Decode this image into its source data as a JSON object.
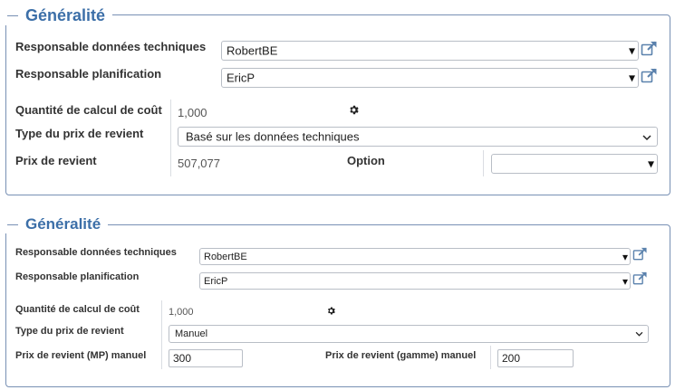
{
  "panel1": {
    "title": "Généralité",
    "tech_manager_label": "Responsable données techniques",
    "tech_manager_value": "RobertBE",
    "planning_manager_label": "Responsable planification",
    "planning_manager_value": "EricP",
    "calc_qty_label": "Quantité de calcul de coût",
    "calc_qty_value": "1,000",
    "cost_type_label": "Type du prix de revient",
    "cost_type_value": "Basé sur les données techniques",
    "cost_price_label": "Prix de revient",
    "cost_price_value": "507,077",
    "option_label": "Option",
    "option_value": ""
  },
  "panel2": {
    "title": "Généralité",
    "tech_manager_label": "Responsable données techniques",
    "tech_manager_value": "RobertBE",
    "planning_manager_label": "Responsable planification",
    "planning_manager_value": "EricP",
    "calc_qty_label": "Quantité de calcul de coût",
    "calc_qty_value": "1,000",
    "cost_type_label": "Type du prix de revient",
    "cost_type_value": "Manuel",
    "mp_cost_label": "Prix de revient (MP) manuel",
    "mp_cost_value": "300",
    "routing_cost_label": "Prix de revient (gamme) manuel",
    "routing_cost_value": "200"
  },
  "icons": {
    "dropdown_arrow": "▾",
    "chevron_down": "⌄",
    "gear": "gear-icon",
    "external_link": "external-link-icon"
  },
  "colors": {
    "accent": "#3c6fa8",
    "border": "#7890b4",
    "link_icon": "#5b82ad"
  }
}
